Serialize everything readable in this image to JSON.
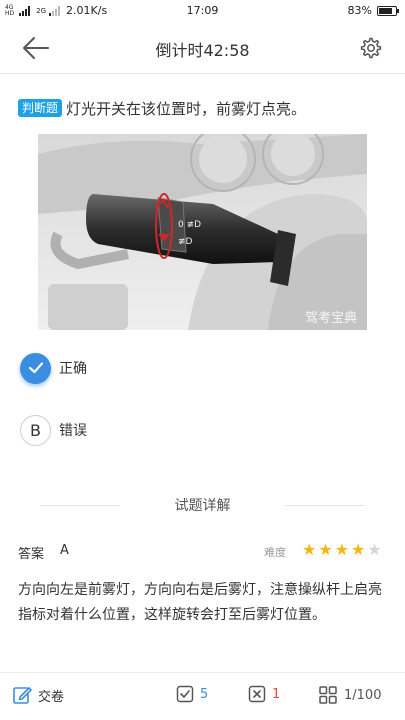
{
  "status_bar": {
    "network_top": "4G",
    "network_bottom": "HD",
    "sim2": "2G",
    "speed": "2.01K/s",
    "time": "17:09",
    "battery": "83%",
    "battery_level": 0.83
  },
  "header": {
    "back_icon": "back-arrow-icon",
    "title": "倒计时42:58",
    "settings_icon": "gear-icon"
  },
  "question": {
    "type_badge": "判断题",
    "text": "灯光开关在该位置时，前雾灯点亮。",
    "image_watermark": "驾考宝典"
  },
  "options": [
    {
      "marker": "✓",
      "label": "正确",
      "selected": true
    },
    {
      "marker": "B",
      "label": "错误",
      "selected": false
    }
  ],
  "explanation": {
    "section_title": "试题详解",
    "answer_label": "答案",
    "answer_value": "A",
    "difficulty_label": "难度",
    "difficulty_stars": 4,
    "difficulty_max": 5,
    "text": "方向向左是前雾灯，方向向右是后雾灯，注意操纵杆上启亮指标对着什么位置，这样旋转会打至后雾灯位置。"
  },
  "bottom_bar": {
    "submit_label": "交卷",
    "correct_count": "5",
    "wrong_count": "1",
    "progress": "1/100"
  },
  "colors": {
    "accent": "#3a8de0",
    "badge": "#1ea1e6",
    "star": "#f6b416",
    "wrong": "#e24b3b"
  }
}
